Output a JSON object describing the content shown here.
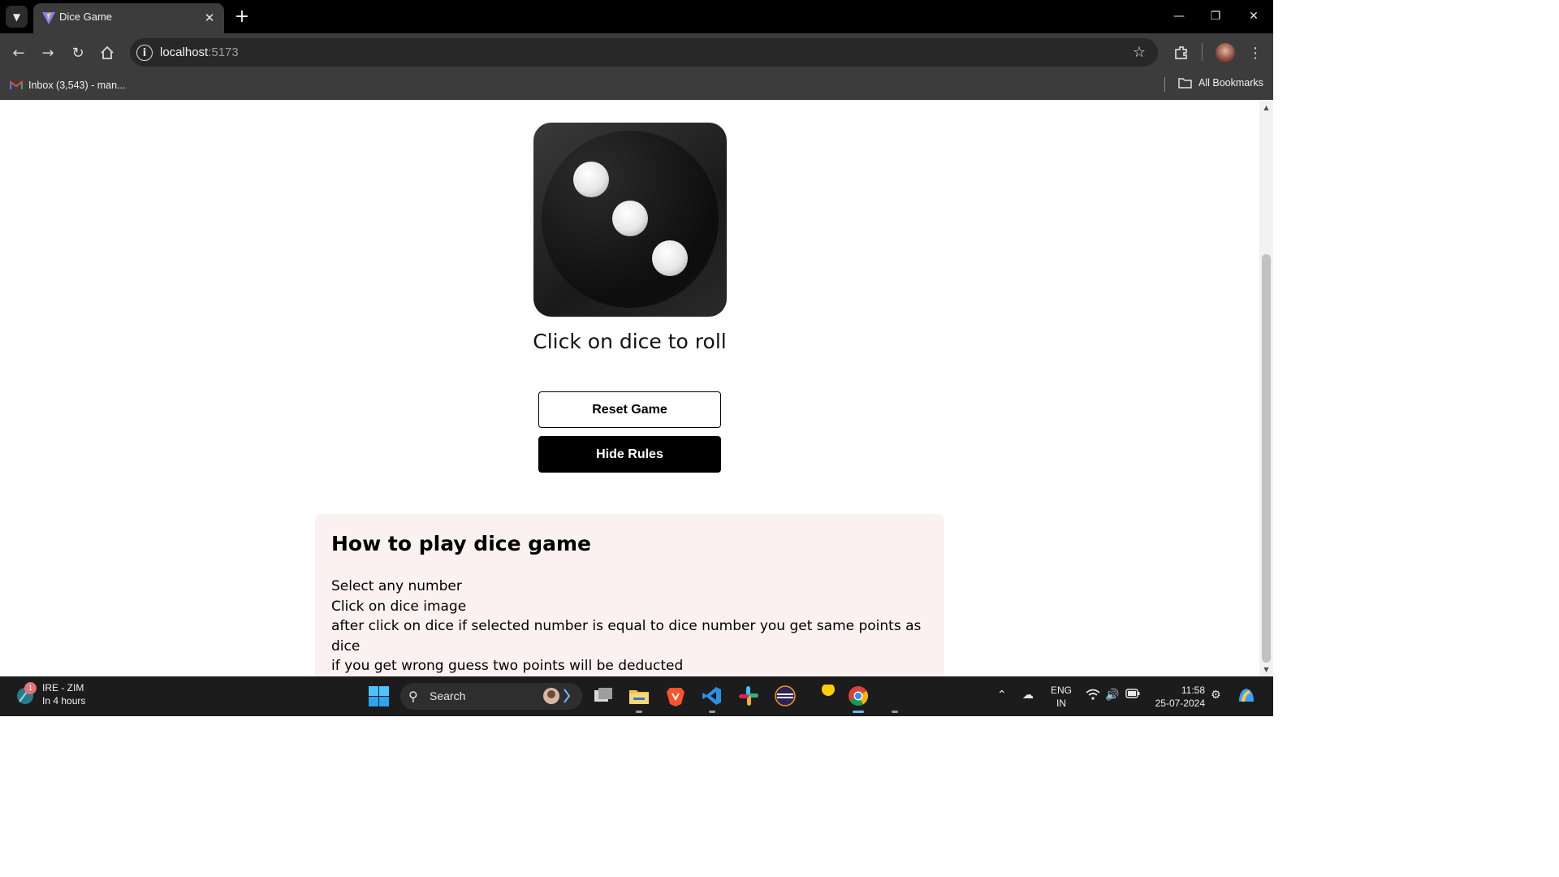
{
  "browser": {
    "tab_title": "Dice Game",
    "url_host": "localhost",
    "url_port": ":5173",
    "bookmarks": [
      {
        "label": "Inbox (3,543) - man...",
        "icon": "gmail-icon"
      }
    ],
    "all_bookmarks_label": "All Bookmarks"
  },
  "game": {
    "dice_value": 3,
    "roll_prompt": "Click on dice to roll",
    "reset_label": "Reset Game",
    "toggle_rules_label": "Hide Rules"
  },
  "rules": {
    "title": "How to play dice game",
    "lines": [
      "Select any number",
      "Click on dice image",
      "after click on dice if selected number is equal to dice number you get same points as dice",
      "if you get wrong guess two points will be deducted"
    ]
  },
  "taskbar": {
    "weather_title": "IRE - ZIM",
    "weather_sub": "In 4 hours",
    "weather_badge": "1",
    "search_placeholder": "Search",
    "lang_line1": "ENG",
    "lang_line2": "IN",
    "time": "11:58",
    "date": "25-07-2024",
    "apps": [
      "task-view-icon",
      "file-explorer-icon",
      "brave-icon",
      "vscode-icon",
      "slack-icon",
      "eclipse-icon",
      "sticky-notes-icon",
      "chrome-icon"
    ]
  },
  "colors": {
    "rules_bg": "#fbf1f1",
    "button_dark": "#000000",
    "titlebar": "#000000",
    "toolbar": "#3c3c3c"
  }
}
